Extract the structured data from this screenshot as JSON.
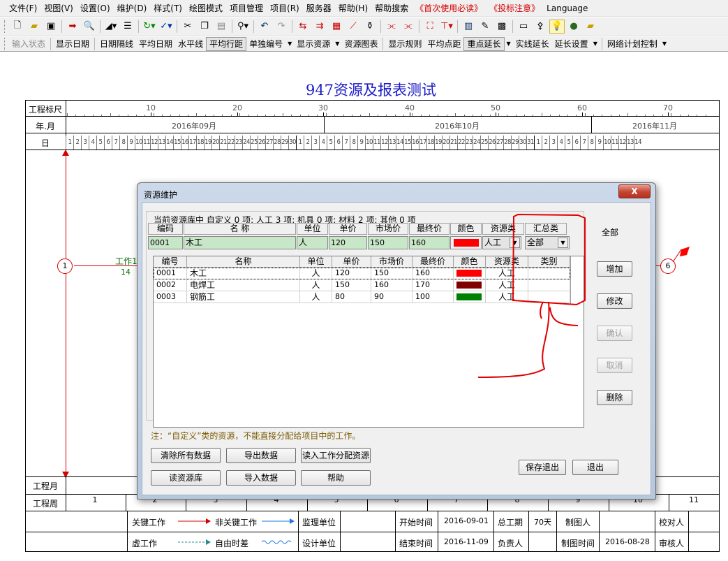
{
  "menubar": {
    "items": [
      "文件(F)",
      "视图(V)",
      "设置(O)",
      "维护(D)",
      "样式(T)",
      "绘图模式",
      "项目管理",
      "项目(R)",
      "服务器",
      "帮助(H)",
      "帮助搜索"
    ],
    "red_items": [
      "《首次使用必读》",
      "《投标注意》"
    ],
    "language": "Language"
  },
  "toolbar1": {
    "icons": [
      "new-icon",
      "open-icon",
      "save-icon",
      "export-icon",
      "print-preview-icon",
      "line-style-icon",
      "indent-icon",
      "refresh-icon",
      "check-icon",
      "cut-icon",
      "copy-icon",
      "paste-icon",
      "find-icon",
      "undo-icon",
      "redo-icon",
      "network-icon",
      "bar-icon",
      "table-icon",
      "curve-icon",
      "resource-icon",
      "split-icon",
      "join-icon",
      "chart-icon",
      "align-icon",
      "library-icon",
      "tools-icon",
      "calc-icon",
      "screen-icon",
      "lamp-icon",
      "idea-icon",
      "globe-icon",
      "folder-icon"
    ]
  },
  "toolbar2": {
    "buttons": [
      "输入状态",
      "显示日期",
      "日期隔线",
      "平均日期",
      "水平线",
      "平均行距",
      "单独编号",
      "显示资源",
      "资源图表",
      "显示规则",
      "平均点距",
      "重点延长",
      "实线延长",
      "延长设置",
      "网络计划控制"
    ]
  },
  "page": {
    "title": "947资源及报表测试",
    "row_labels": {
      "ruler": "工程标尺",
      "year_month": "年.月",
      "day": "日",
      "month": "工程月",
      "week": "工程周"
    },
    "ruler_ticks": [
      "10",
      "20",
      "30",
      "40",
      "50",
      "60",
      "70"
    ],
    "months": [
      "2016年09月",
      "2016年10月",
      "2016年11月"
    ],
    "days_sep": [
      "1",
      "2",
      "3",
      "4",
      "5",
      "6",
      "7",
      "8",
      "9",
      "10",
      "11",
      "12",
      "13",
      "14",
      "15",
      "16",
      "17",
      "18",
      "19",
      "20",
      "21",
      "22",
      "23",
      "24",
      "25",
      "26",
      "27",
      "28",
      "29",
      "30"
    ],
    "days_oct": [
      "1",
      "2",
      "3",
      "4",
      "5",
      "6",
      "7",
      "8",
      "9",
      "10",
      "11",
      "12",
      "13",
      "14",
      "15",
      "16",
      "17",
      "18",
      "19",
      "20",
      "21",
      "22",
      "23",
      "24",
      "25",
      "26",
      "27",
      "28",
      "29",
      "30",
      "31"
    ],
    "days_nov": [
      "1",
      "2",
      "3",
      "4",
      "5",
      "6",
      "7",
      "8",
      "9",
      "10",
      "11",
      "12",
      "13",
      "14"
    ],
    "weeks": [
      "1",
      "2",
      "3",
      "4",
      "5",
      "6",
      "7",
      "8",
      "9",
      "10",
      "11"
    ],
    "nodes": {
      "start": "1",
      "end": "6"
    },
    "work": {
      "name": "工作1",
      "duration": "14"
    }
  },
  "legend": {
    "critical": "关键工作",
    "non_critical": "非关键工作",
    "virtual": "虚工作",
    "free_float": "自由时差",
    "supervisor": "监理单位",
    "designer": "设计单位",
    "start_label": "开始时间",
    "start_value": "2016-09-01",
    "end_label": "结束时间",
    "end_value": "2016-11-09",
    "total_label": "总工期",
    "total_value": "70天",
    "owner_label": "负责人",
    "drawer_label": "制图人",
    "draw_time_label": "制图时间",
    "draw_time_value": "2016-08-28",
    "checker_label": "校对人",
    "reviewer_label": "审核人"
  },
  "dialog": {
    "title": "资源维护",
    "close_label": "X",
    "summary": "当前资源库中 自定义 0 项; 人工 3 项; 机具 0 项; 材料 2 项; 其他 0 项",
    "edit_headers": [
      "编码",
      "名    称",
      "单位",
      "单价",
      "市场价",
      "最终价",
      "颜色",
      "资源类",
      "汇总类"
    ],
    "edit_row": {
      "code": "0001",
      "name": "木工",
      "unit": "人",
      "price": "120",
      "market": "150",
      "final": "160",
      "color": "#ff0000",
      "type": "人工",
      "summary": "全部"
    },
    "grid_headers": [
      "编号",
      "名称",
      "单位",
      "单价",
      "市场价",
      "最终价",
      "颜色",
      "资源类",
      "类别"
    ],
    "rows": [
      {
        "code": "0001",
        "name": "木工",
        "unit": "人",
        "price": "120",
        "market": "150",
        "final": "160",
        "color": "#ff0000",
        "type": "人工",
        "category": ""
      },
      {
        "code": "0002",
        "name": "电焊工",
        "unit": "人",
        "price": "150",
        "market": "160",
        "final": "170",
        "color": "#800000",
        "type": "人工",
        "category": ""
      },
      {
        "code": "0003",
        "name": "钢筋工",
        "unit": "人",
        "price": "80",
        "market": "90",
        "final": "100",
        "color": "#008000",
        "type": "人工",
        "category": ""
      }
    ],
    "right_label": "全部",
    "buttons": {
      "add": "增加",
      "modify": "修改",
      "confirm": "确认",
      "cancel": "取消",
      "delete": "删除"
    },
    "note": "注：“自定义”类的资源，不能直接分配给项目中的工作。",
    "bottom_buttons": {
      "clear": "清除所有数据",
      "export": "导出数据",
      "read_assign": "读入工作分配资源",
      "read_lib": "读资源库",
      "import": "导入数据",
      "help": "帮助",
      "save_exit": "保存退出",
      "exit": "退出"
    }
  },
  "colors": {
    "accent_red": "#d40000",
    "title_blue": "#1c1cc8",
    "green_text": "#007000"
  }
}
